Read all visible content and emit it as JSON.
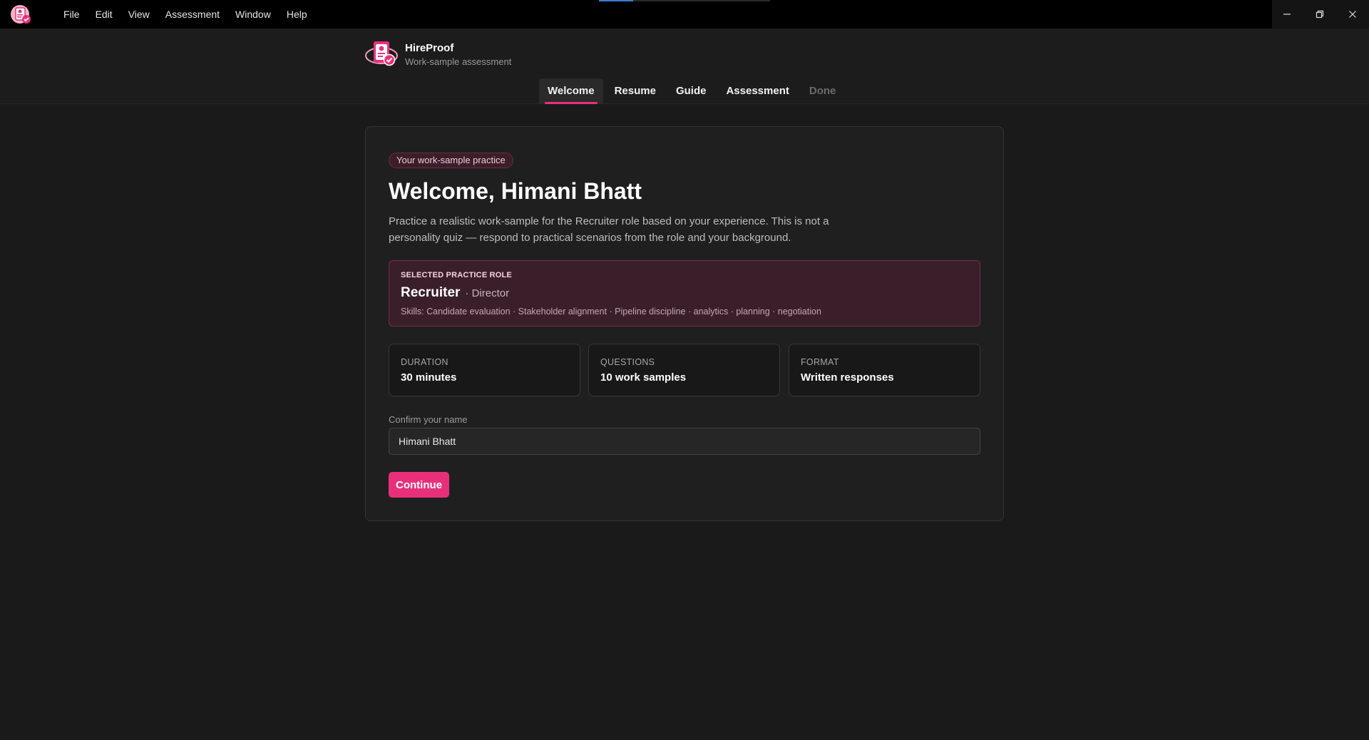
{
  "menubar": {
    "items": [
      "File",
      "Edit",
      "View",
      "Assessment",
      "Window",
      "Help"
    ],
    "window_controls": [
      "minimize-icon",
      "restore-icon",
      "close-icon"
    ]
  },
  "brand": {
    "name": "HireProof",
    "subtitle": "Work-sample assessment",
    "accent": "#e8307a"
  },
  "tabs": [
    {
      "label": "Welcome",
      "state": "active"
    },
    {
      "label": "Resume",
      "state": "enabled"
    },
    {
      "label": "Guide",
      "state": "enabled"
    },
    {
      "label": "Assessment",
      "state": "enabled"
    },
    {
      "label": "Done",
      "state": "disabled"
    }
  ],
  "welcome": {
    "pill": "Your work-sample practice",
    "title": "Welcome, Himani Bhatt",
    "intro": "Practice a realistic work-sample for the Recruiter role based on your experience. This is not a personality quiz — respond to practical scenarios from the role and your background."
  },
  "role": {
    "kicker": "SELECTED PRACTICE ROLE",
    "name": "Recruiter",
    "level": "· Director",
    "skills": "Skills: Candidate evaluation · Stakeholder alignment · Pipeline discipline · analytics · planning · negotiation"
  },
  "stats": [
    {
      "label": "DURATION",
      "value": "30 minutes"
    },
    {
      "label": "QUESTIONS",
      "value": "10 work samples"
    },
    {
      "label": "FORMAT",
      "value": "Written responses"
    }
  ],
  "name_field": {
    "label": "Confirm your name",
    "value": "Himani Bhatt"
  },
  "continue_label": "Continue"
}
